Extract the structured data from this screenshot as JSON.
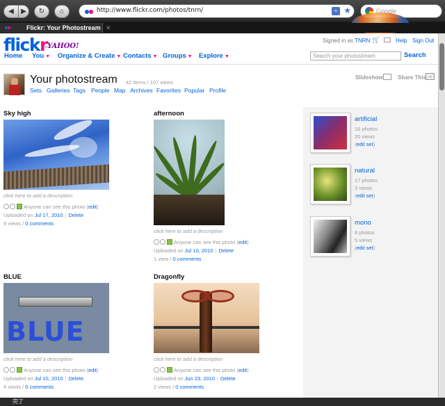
{
  "browser": {
    "url": "http://www.flickr.com/photos/tnrn/",
    "search_placeholder": "Google",
    "tab_title": "Flickr: Your Photostream",
    "status_text": "完了"
  },
  "header": {
    "logo_blue": "flick",
    "logo_pink": "r",
    "from_text": "from",
    "yahoo_text": "YAHOO!",
    "signed_in_prefix": "Signed in as",
    "username": "TNRN",
    "help": "Help",
    "sign_out": "Sign Out",
    "search_placeholder": "Search your photostream",
    "search_button": "Search",
    "nav": [
      "Home",
      "You",
      "Organize & Create",
      "Contacts",
      "Groups",
      "Explore"
    ]
  },
  "photostream": {
    "title": "Your photostream",
    "meta": "42 items / 107 views",
    "subnav": [
      "Sets",
      "Galleries",
      "Tags",
      "People",
      "Map",
      "Archives",
      "Favorites",
      "Popular",
      "Profile"
    ],
    "slideshow": "Slideshow",
    "share": "Share This"
  },
  "photos": [
    {
      "title": "Sky high",
      "desc": "click here to add a description",
      "visibility": "Anyone can see this photo",
      "edit": "edit",
      "uploaded_prefix": "Uploaded on",
      "date": "Jul 17, 2010",
      "delete": "Delete",
      "views": "9 views",
      "comments": "0 comments"
    },
    {
      "title": "afternoon",
      "desc": "click here to add a description",
      "visibility": "Anyone can see this photo",
      "edit": "edit",
      "uploaded_prefix": "Uploaded on",
      "date": "Jul 10, 2010",
      "delete": "Delete",
      "views": "1 view",
      "comments": "0 comments"
    },
    {
      "title": "BLUE",
      "desc": "click here to add a description",
      "visibility": "Anyone can see this photo",
      "edit": "edit",
      "uploaded_prefix": "Uploaded on",
      "date": "Jul 10, 2010",
      "delete": "Delete",
      "views": "4 views",
      "comments": "0 comments"
    },
    {
      "title": "Dragonfly",
      "desc": "click here to add a description",
      "visibility": "Anyone can see this photo",
      "edit": "edit",
      "uploaded_prefix": "Uploaded on",
      "date": "Jun 23, 2010",
      "delete": "Delete",
      "views": "2 views",
      "comments": "0 comments"
    }
  ],
  "blue_image_text": "BLUE",
  "sets": [
    {
      "name": "artificial",
      "count": "16 photos",
      "views": "20 views",
      "edit": "edit set"
    },
    {
      "name": "natural",
      "count": "17 photos",
      "views": "3 views",
      "edit": "edit set"
    },
    {
      "name": "mono",
      "count": "8 photos",
      "views": "5 views",
      "edit": "edit set"
    }
  ],
  "colors": {
    "flickr_blue": "#0063dc",
    "flickr_pink": "#ff0084",
    "yahoo_purple": "#7b0099"
  }
}
